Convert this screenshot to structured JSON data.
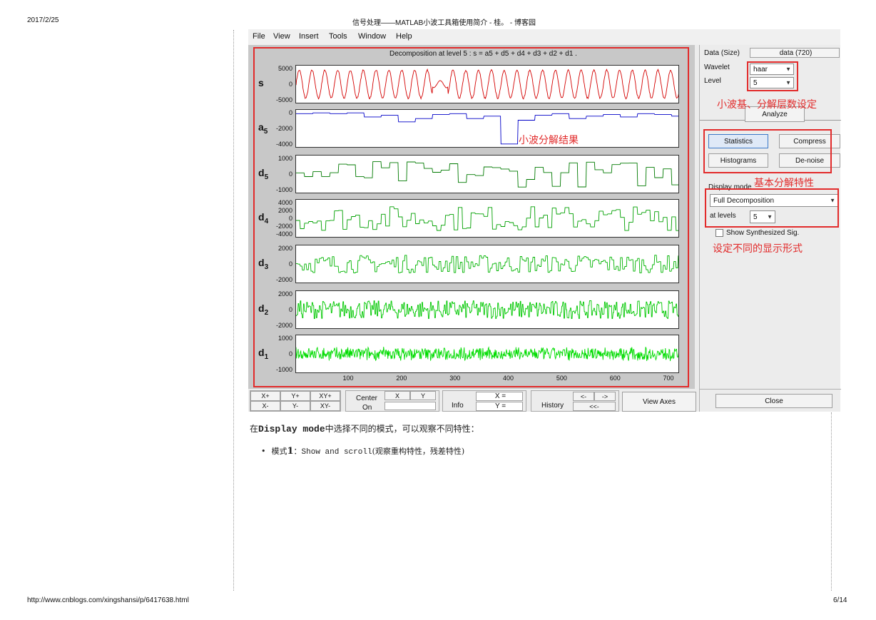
{
  "page_header": {
    "date": "2017/2/25",
    "title": "信号处理——MATLAB小波工具箱使用简介 - 桂。 - 博客园"
  },
  "page_footer": {
    "url": "http://www.cnblogs.com/xingshansi/p/6417638.html",
    "page": "6/14"
  },
  "menu": [
    "File",
    "View",
    "Insert",
    "Tools",
    "Window",
    "Help"
  ],
  "plot": {
    "title": "Decomposition at level 5 : s = a5 + d5 + d4 + d3 + d2 + d1 .",
    "rows": [
      {
        "name": "s",
        "sub": "",
        "ticks": [
          "5000",
          "0",
          "-5000"
        ],
        "color": "#d40000"
      },
      {
        "name": "a",
        "sub": "5",
        "ticks": [
          "0",
          "-2000",
          "-4000"
        ],
        "color": "#0000c8"
      },
      {
        "name": "d",
        "sub": "5",
        "ticks": [
          "1000",
          "0",
          "-1000"
        ],
        "color": "#007a00"
      },
      {
        "name": "d",
        "sub": "4",
        "ticks": [
          "4000",
          "2000",
          "0",
          "-2000",
          "-4000"
        ],
        "color": "#00a000"
      },
      {
        "name": "d",
        "sub": "3",
        "ticks": [
          "2000",
          "0",
          "-2000"
        ],
        "color": "#00b400"
      },
      {
        "name": "d",
        "sub": "2",
        "ticks": [
          "2000",
          "0",
          "-2000"
        ],
        "color": "#00c800"
      },
      {
        "name": "d",
        "sub": "1",
        "ticks": [
          "1000",
          "0",
          "-1000"
        ],
        "color": "#00dc00"
      }
    ],
    "xticks": [
      "100",
      "200",
      "300",
      "400",
      "500",
      "600",
      "700"
    ],
    "x_range": [
      1,
      720
    ]
  },
  "annotations": {
    "result": "小波分解结果",
    "wavelet_level": "小波基、分解层数设定",
    "basic_features": "基本分解特性",
    "display_form": "设定不同的显示形式"
  },
  "right_panel": {
    "data_label": "Data (Size)",
    "data_value": "data (720)",
    "wavelet_label": "Wavelet",
    "wavelet_value": "haar",
    "level_label": "Level",
    "level_value": "5",
    "analyze": "Analyze",
    "statistics": "Statistics",
    "compress": "Compress",
    "histograms": "Histograms",
    "denoise": "De-noise",
    "display_mode_label": "Display mode",
    "display_mode_value": "Full Decomposition",
    "at_levels_label": "at levels",
    "at_levels_value": "5",
    "show_synth": "Show Synthesized Sig.",
    "close": "Close"
  },
  "bottom_bar": {
    "xplus": "X+",
    "yplus": "Y+",
    "xyplus": "XY+",
    "xminus": "X-",
    "yminus": "Y-",
    "xyminus": "XY-",
    "center_label": "Center",
    "on_label": "On",
    "center_x": "X",
    "center_y": "Y",
    "info": "Info",
    "x_eq": "X =",
    "y_eq": "Y =",
    "history": "History",
    "hist_back": "<-",
    "hist_fwd": "->",
    "hist_first": "<<-",
    "view_axes": "View Axes"
  },
  "body_text": {
    "line1_pre": "在",
    "line1_code": "Display mode",
    "line1_post": "中选择不同的模式，可以观察不同特性：",
    "bullet1_pre": "模式",
    "bullet1_num": "1",
    "bullet1_colon": "：",
    "bullet1_code": "Show and scroll",
    "bullet1_post": "(观察重构特性，残差特性)"
  }
}
